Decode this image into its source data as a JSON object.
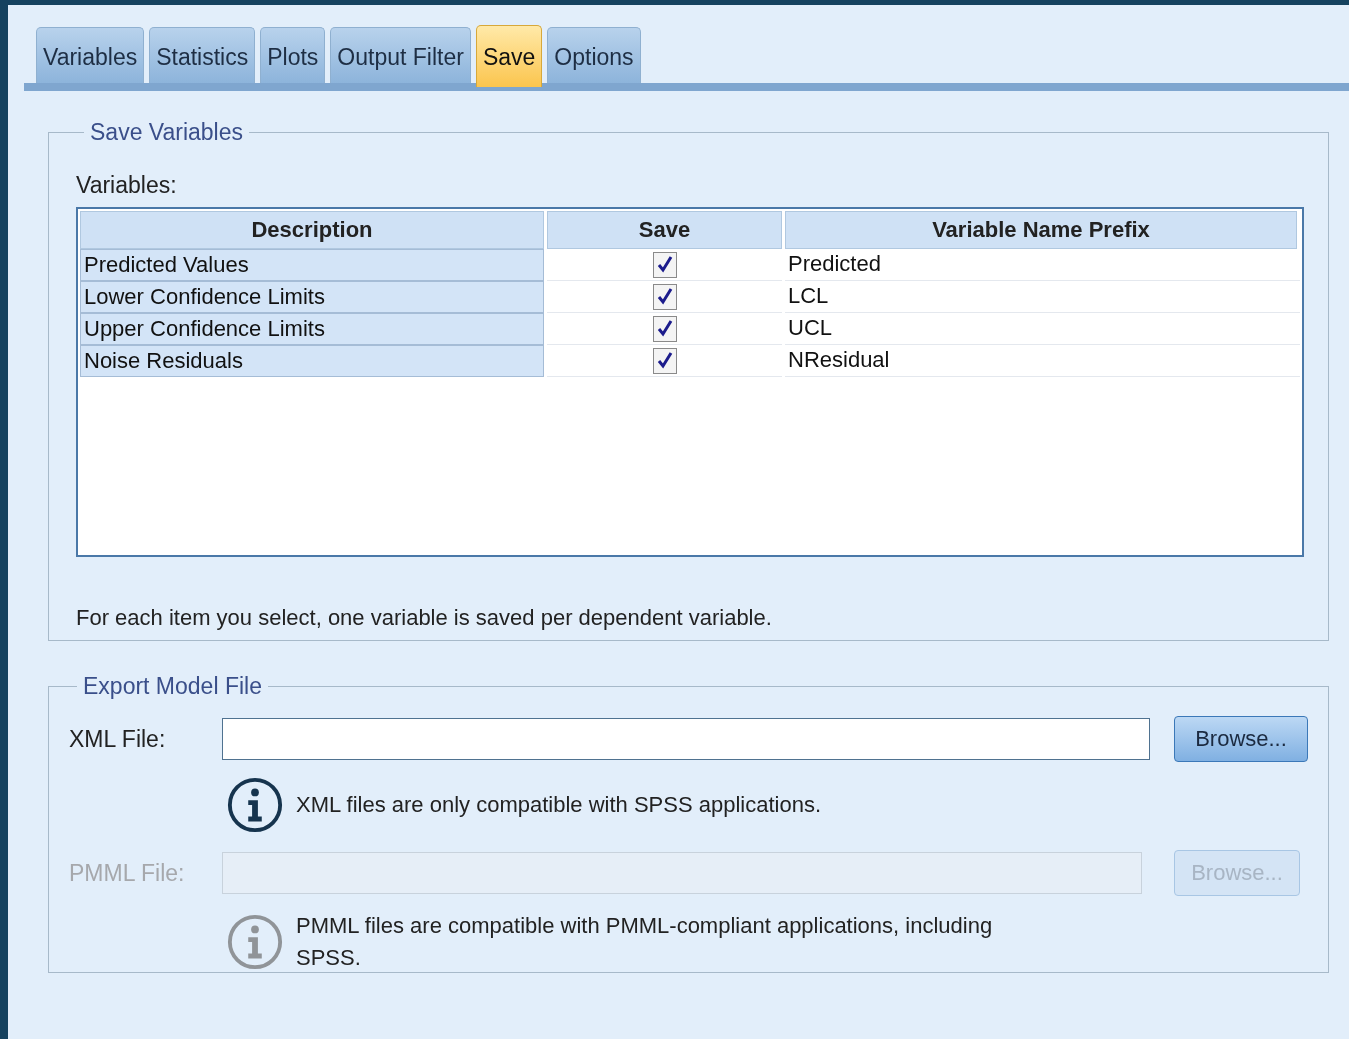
{
  "tabs": [
    {
      "label": "Variables",
      "selected": false
    },
    {
      "label": "Statistics",
      "selected": false
    },
    {
      "label": "Plots",
      "selected": false
    },
    {
      "label": "Output Filter",
      "selected": false
    },
    {
      "label": "Save",
      "selected": true
    },
    {
      "label": "Options",
      "selected": false
    }
  ],
  "save_variables": {
    "title": "Save Variables",
    "label": "Variables:",
    "table": {
      "columns": [
        "Description",
        "Save",
        "Variable Name Prefix"
      ],
      "rows": [
        {
          "description": "Predicted Values",
          "checked": true,
          "prefix": "Predicted"
        },
        {
          "description": "Lower Confidence Limits",
          "checked": true,
          "prefix": "LCL"
        },
        {
          "description": "Upper Confidence Limits",
          "checked": true,
          "prefix": "UCL"
        },
        {
          "description": "Noise Residuals",
          "checked": true,
          "prefix": "NResidual"
        }
      ]
    },
    "note": "For each item you select, one variable is saved per dependent variable."
  },
  "export_model_file": {
    "title": "Export Model File",
    "files": [
      {
        "label": "XML File:",
        "disabled": false,
        "button": "Browse...",
        "info": "XML files are only compatible with SPSS applications."
      },
      {
        "label": "PMML File:",
        "disabled": true,
        "button": "Browse...",
        "info": "PMML files are compatible with PMML-compliant applications, including SPSS."
      }
    ]
  }
}
